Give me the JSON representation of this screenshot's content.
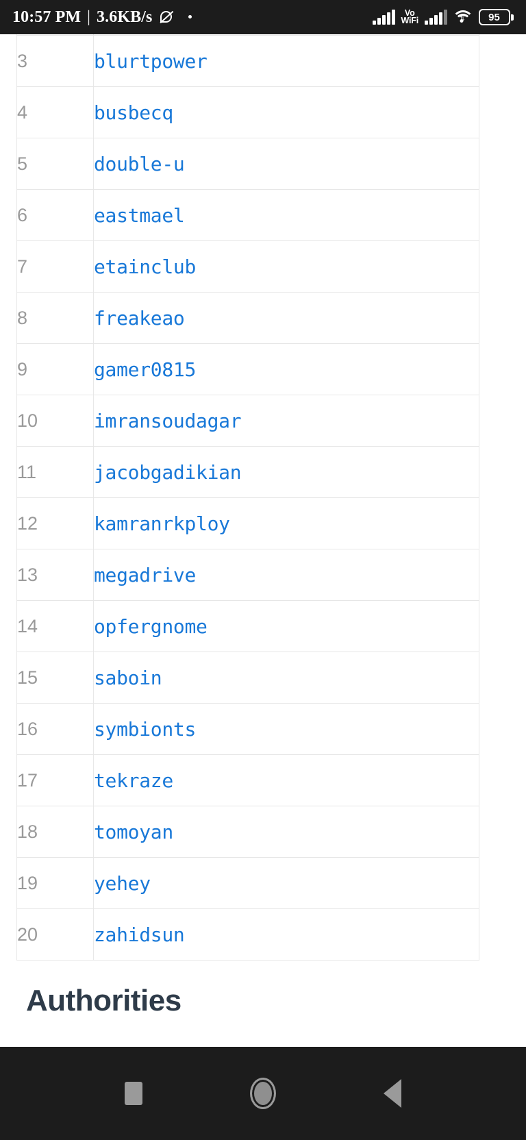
{
  "status_bar": {
    "time": "10:57 PM",
    "separator": "|",
    "network_speed": "3.6KB/s",
    "dnd_icon": "do-not-disturb-icon",
    "volte_line1": "Vo",
    "volte_line2": "WiFi",
    "signal_icon_1": "cellular-signal-icon",
    "signal_icon_2": "cellular-signal-icon",
    "wifi_icon": "wifi-icon",
    "battery_level": "95"
  },
  "table": {
    "rows": [
      {
        "rank": "3",
        "name": "blurtpower"
      },
      {
        "rank": "4",
        "name": "busbecq"
      },
      {
        "rank": "5",
        "name": "double-u"
      },
      {
        "rank": "6",
        "name": "eastmael"
      },
      {
        "rank": "7",
        "name": "etainclub"
      },
      {
        "rank": "8",
        "name": "freakeao"
      },
      {
        "rank": "9",
        "name": "gamer0815"
      },
      {
        "rank": "10",
        "name": "imransoudagar"
      },
      {
        "rank": "11",
        "name": "jacobgadikian"
      },
      {
        "rank": "12",
        "name": "kamranrkploy"
      },
      {
        "rank": "13",
        "name": "megadrive"
      },
      {
        "rank": "14",
        "name": "opfergnome"
      },
      {
        "rank": "15",
        "name": "saboin"
      },
      {
        "rank": "16",
        "name": "symbionts"
      },
      {
        "rank": "17",
        "name": "tekraze"
      },
      {
        "rank": "18",
        "name": "tomoyan"
      },
      {
        "rank": "19",
        "name": "yehey"
      },
      {
        "rank": "20",
        "name": "zahidsun"
      }
    ]
  },
  "section": {
    "heading": "Authorities"
  },
  "nav_bar": {
    "recents_label": "recents-square-icon",
    "home_label": "home-circle-icon",
    "back_label": "back-triangle-icon"
  },
  "colors": {
    "link": "#1878d8",
    "rank_text": "#9a9a9a",
    "heading": "#2e3b49",
    "system_bar": "#1c1c1c",
    "border": "#e6e6e6"
  }
}
